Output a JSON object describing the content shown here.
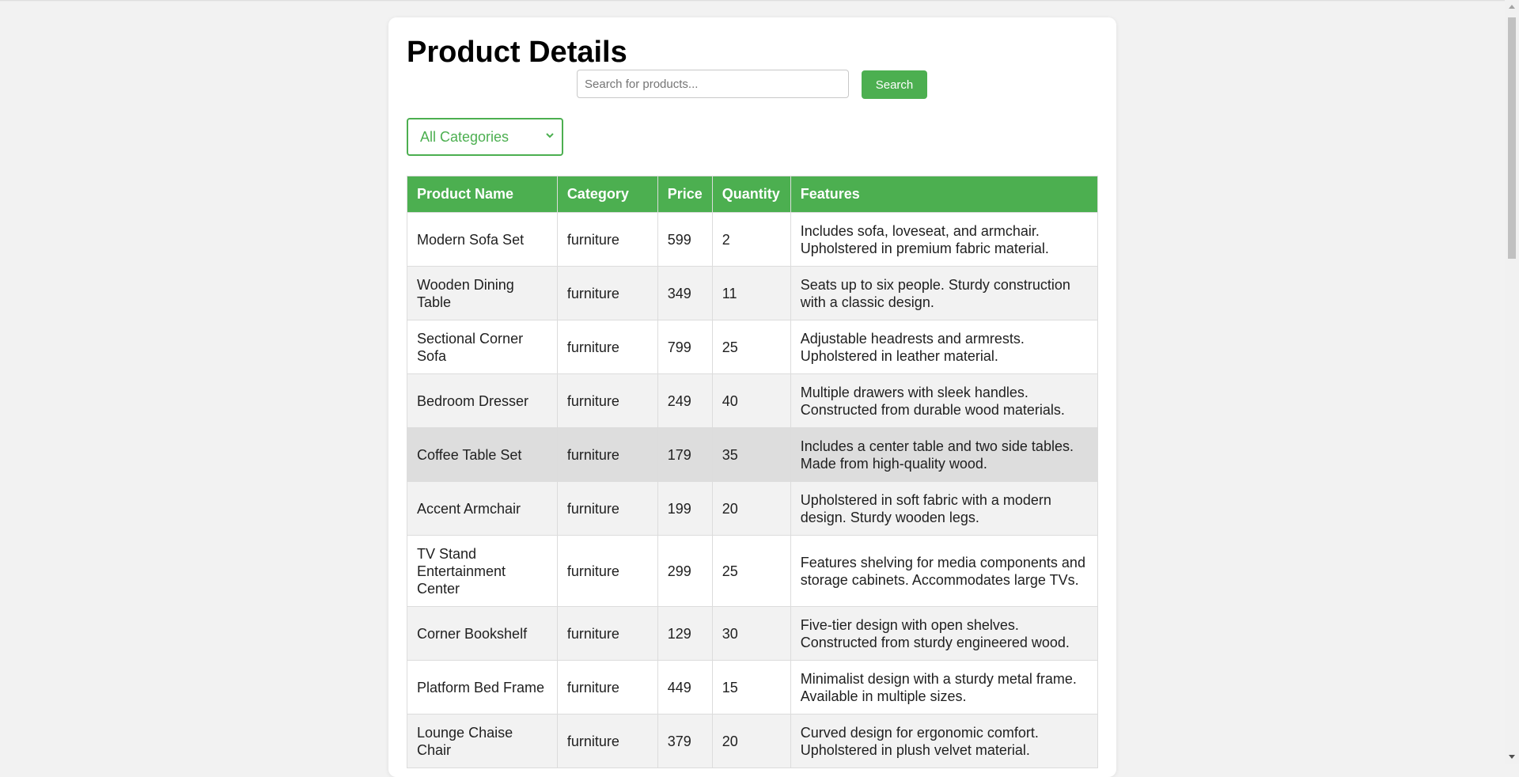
{
  "page": {
    "title": "Product Details"
  },
  "search": {
    "placeholder": "Search for products...",
    "value": "",
    "button_label": "Search"
  },
  "filter": {
    "selected": "All Categories",
    "icon": "chevron-down-icon"
  },
  "colors": {
    "accent": "#4caf50",
    "row_alt": "#f2f2f2",
    "row_hover": "#dddddd"
  },
  "table": {
    "columns": [
      "Product Name",
      "Category",
      "Price",
      "Quantity",
      "Features"
    ],
    "rows": [
      {
        "name": "Modern Sofa Set",
        "category": "furniture",
        "price": "599",
        "quantity": "2",
        "features": "Includes sofa, loveseat, and armchair. Upholstered in premium fabric material."
      },
      {
        "name": "Wooden Dining Table",
        "category": "furniture",
        "price": "349",
        "quantity": "11",
        "features": "Seats up to six people. Sturdy construction with a classic design."
      },
      {
        "name": "Sectional Corner Sofa",
        "category": "furniture",
        "price": "799",
        "quantity": "25",
        "features": "Adjustable headrests and armrests. Upholstered in leather material."
      },
      {
        "name": "Bedroom Dresser",
        "category": "furniture",
        "price": "249",
        "quantity": "40",
        "features": "Multiple drawers with sleek handles. Constructed from durable wood materials."
      },
      {
        "name": "Coffee Table Set",
        "category": "furniture",
        "price": "179",
        "quantity": "35",
        "features": "Includes a center table and two side tables. Made from high-quality wood."
      },
      {
        "name": "Accent Armchair",
        "category": "furniture",
        "price": "199",
        "quantity": "20",
        "features": "Upholstered in soft fabric with a modern design. Sturdy wooden legs."
      },
      {
        "name": "TV Stand Entertainment Center",
        "category": "furniture",
        "price": "299",
        "quantity": "25",
        "features": "Features shelving for media components and storage cabinets. Accommodates large TVs."
      },
      {
        "name": "Corner Bookshelf",
        "category": "furniture",
        "price": "129",
        "quantity": "30",
        "features": "Five-tier design with open shelves. Constructed from sturdy engineered wood."
      },
      {
        "name": "Platform Bed Frame",
        "category": "furniture",
        "price": "449",
        "quantity": "15",
        "features": "Minimalist design with a sturdy metal frame. Available in multiple sizes."
      },
      {
        "name": "Lounge Chaise Chair",
        "category": "furniture",
        "price": "379",
        "quantity": "20",
        "features": "Curved design for ergonomic comfort. Upholstered in plush velvet material."
      }
    ]
  }
}
